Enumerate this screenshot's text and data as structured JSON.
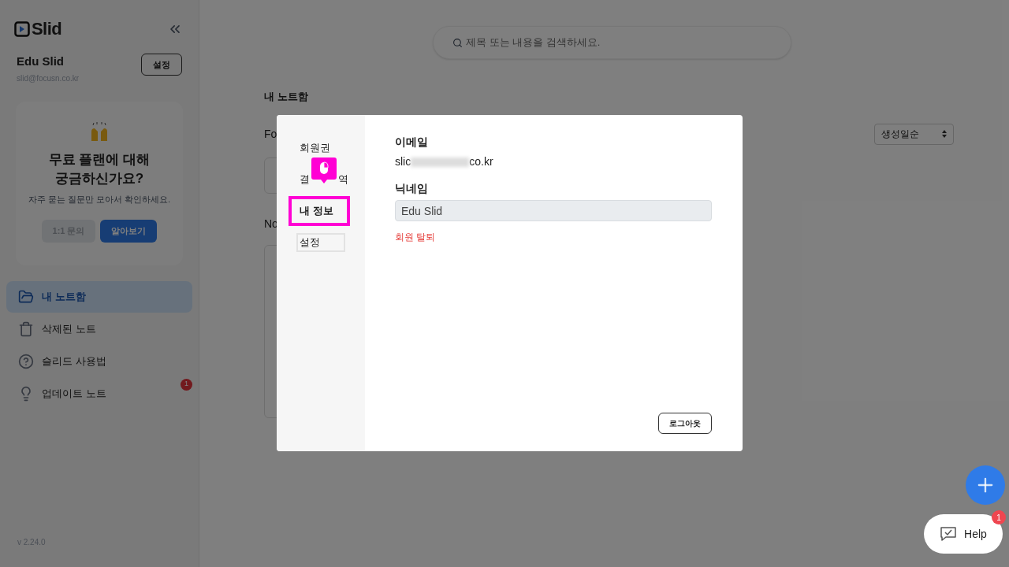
{
  "sidebar": {
    "logo": "Slid",
    "user": {
      "name": "Edu Slid",
      "email": "slid@focusn.co.kr",
      "settings_button": "설정"
    },
    "promo": {
      "title_lines": [
        "무료 플랜에 대해",
        "궁금하신가요?"
      ],
      "subtitle": "자주 묻는 질문만 모아서 확인하세요.",
      "buttons": [
        {
          "label": "1:1 문의",
          "kind": "secondary"
        },
        {
          "label": "알아보기",
          "kind": "primary"
        }
      ]
    },
    "nav": [
      {
        "label": "내 노트함",
        "kind": "folder",
        "selected": true
      },
      {
        "label": "삭제된 노트",
        "kind": "trash",
        "selected": false
      },
      {
        "label": "슬리드 사용법",
        "kind": "help",
        "selected": false
      },
      {
        "label": "업데이트 노트",
        "kind": "bulb",
        "selected": false,
        "badge": "1"
      }
    ],
    "version": "v 2.24.0"
  },
  "main": {
    "search": {
      "placeholder": "제목 또는 내용을 검색하세요."
    },
    "heading": "내 노트함",
    "folders_label": "Fo",
    "notes_label": "No",
    "sort": "생성일순"
  },
  "modal": {
    "menu": [
      {
        "kind": "plain",
        "label": "회원권",
        "selected": false
      },
      {
        "kind": "covered",
        "label_start": "결",
        "label_end": "역",
        "selected": false
      },
      {
        "kind": "plain",
        "label": "내 정보",
        "selected": true
      },
      {
        "kind": "plain",
        "label": "설정",
        "selected": false
      }
    ],
    "email_label": "이메일",
    "email_start": "slic",
    "email_end": "co.kr",
    "nickname_label": "닉네임",
    "nickname": "Edu Slid",
    "withdraw": "회원 탈퇴",
    "logout": "로그아웃"
  },
  "help": {
    "label": "Help",
    "badge": "1"
  }
}
